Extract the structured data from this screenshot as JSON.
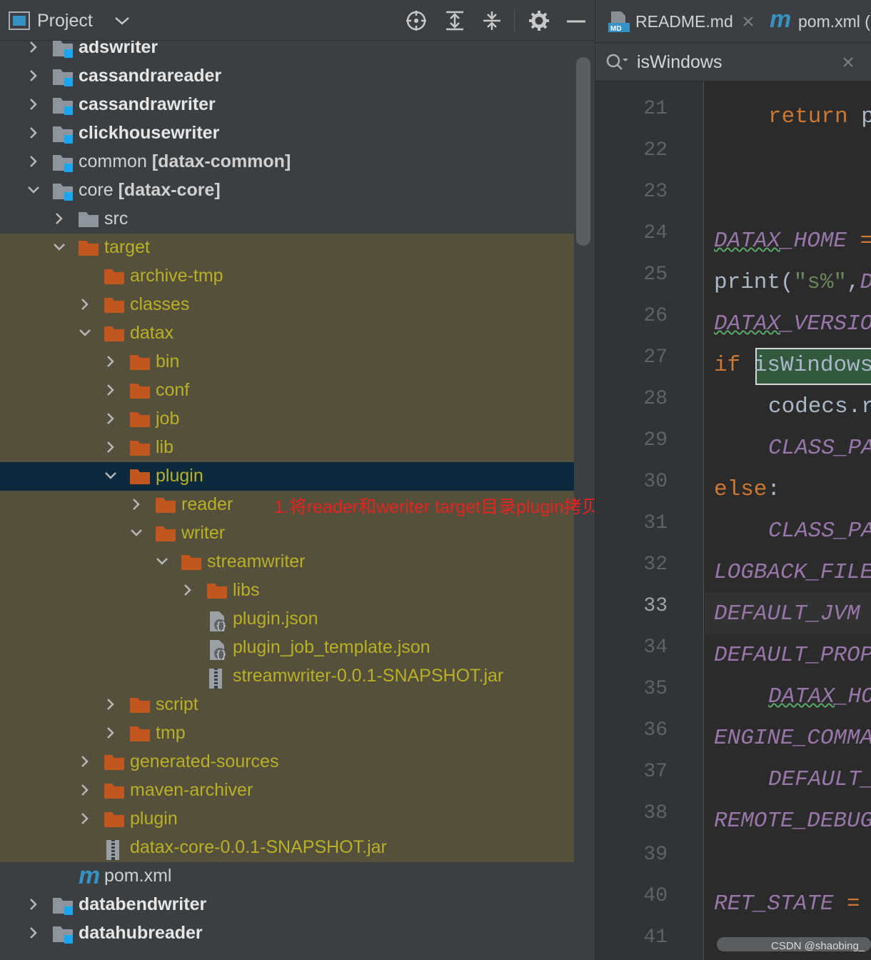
{
  "project_panel": {
    "title": "Project"
  },
  "tree": [
    {
      "label": "adswriter",
      "indent": 0,
      "arrow": "right",
      "icon": "module-folder",
      "style": "module"
    },
    {
      "label": "cassandrareader",
      "indent": 0,
      "arrow": "right",
      "icon": "module-folder",
      "style": "module"
    },
    {
      "label": "cassandrawriter",
      "indent": 0,
      "arrow": "right",
      "icon": "module-folder",
      "style": "module"
    },
    {
      "label": "clickhousewriter",
      "indent": 0,
      "arrow": "right",
      "icon": "module-folder",
      "style": "module"
    },
    {
      "label": "common ",
      "label_bold": "[datax-common]",
      "indent": 0,
      "arrow": "right",
      "icon": "module-folder",
      "style": "normal"
    },
    {
      "label": "core ",
      "label_bold": "[datax-core]",
      "indent": 0,
      "arrow": "down",
      "icon": "module-folder",
      "style": "normal"
    },
    {
      "label": "src",
      "indent": 1,
      "arrow": "right",
      "icon": "gray-folder",
      "style": "src"
    },
    {
      "label": "target",
      "indent": 1,
      "arrow": "down",
      "icon": "orange-folder",
      "style": "olive"
    },
    {
      "label": "archive-tmp",
      "indent": 2,
      "arrow": "none",
      "icon": "orange-folder",
      "style": "olive"
    },
    {
      "label": "classes",
      "indent": 2,
      "arrow": "right",
      "icon": "orange-folder",
      "style": "olive"
    },
    {
      "label": "datax",
      "indent": 2,
      "arrow": "down",
      "icon": "orange-folder",
      "style": "olive"
    },
    {
      "label": "bin",
      "indent": 3,
      "arrow": "right",
      "icon": "orange-folder",
      "style": "olive"
    },
    {
      "label": "conf",
      "indent": 3,
      "arrow": "right",
      "icon": "orange-folder",
      "style": "olive"
    },
    {
      "label": "job",
      "indent": 3,
      "arrow": "right",
      "icon": "orange-folder",
      "style": "olive"
    },
    {
      "label": "lib",
      "indent": 3,
      "arrow": "right",
      "icon": "orange-folder",
      "style": "olive"
    },
    {
      "label": "plugin",
      "indent": 3,
      "arrow": "down",
      "icon": "orange-folder",
      "style": "selected"
    },
    {
      "label": "reader",
      "indent": 4,
      "arrow": "right",
      "icon": "orange-folder",
      "style": "olive"
    },
    {
      "label": "writer",
      "indent": 4,
      "arrow": "down",
      "icon": "orange-folder",
      "style": "olive"
    },
    {
      "label": "streamwriter",
      "indent": 5,
      "arrow": "down",
      "icon": "orange-folder",
      "style": "olive"
    },
    {
      "label": "libs",
      "indent": 6,
      "arrow": "right",
      "icon": "orange-folder",
      "style": "olive"
    },
    {
      "label": "plugin.json",
      "indent": 6,
      "arrow": "none",
      "icon": "json-file",
      "style": "olive"
    },
    {
      "label": "plugin_job_template.json",
      "indent": 6,
      "arrow": "none",
      "icon": "json-file",
      "style": "olive"
    },
    {
      "label": "streamwriter-0.0.1-SNAPSHOT.jar",
      "indent": 6,
      "arrow": "none",
      "icon": "jar-file",
      "style": "olive"
    },
    {
      "label": "script",
      "indent": 3,
      "arrow": "right",
      "icon": "orange-folder",
      "style": "olive"
    },
    {
      "label": "tmp",
      "indent": 3,
      "arrow": "right",
      "icon": "orange-folder",
      "style": "olive"
    },
    {
      "label": "generated-sources",
      "indent": 2,
      "arrow": "right",
      "icon": "orange-folder",
      "style": "olive"
    },
    {
      "label": "maven-archiver",
      "indent": 2,
      "arrow": "right",
      "icon": "orange-folder",
      "style": "olive"
    },
    {
      "label": "plugin",
      "indent": 2,
      "arrow": "right",
      "icon": "orange-folder",
      "style": "olive"
    },
    {
      "label": "datax-core-0.0.1-SNAPSHOT.jar",
      "indent": 2,
      "arrow": "none",
      "icon": "jar-file",
      "style": "olive"
    },
    {
      "label": "pom.xml",
      "indent": 1,
      "arrow": "none",
      "icon": "maven-file",
      "style": "normal"
    },
    {
      "label": "databendwriter",
      "indent": 0,
      "arrow": "right",
      "icon": "module-folder",
      "style": "module"
    },
    {
      "label": "datahubreader",
      "indent": 0,
      "arrow": "right",
      "icon": "module-folder",
      "style": "module"
    }
  ],
  "annotation": "1.将reader和weriter target目录plugin拷贝",
  "editor": {
    "tabs": [
      {
        "label": "README.md",
        "icon": "markdown-icon"
      },
      {
        "label": "pom.xml (",
        "icon": "maven-icon"
      }
    ],
    "search": {
      "value": "isWindows"
    },
    "line_numbers": [
      "21",
      "22",
      "23",
      "24",
      "25",
      "26",
      "27",
      "28",
      "29",
      "30",
      "31",
      "32",
      "33",
      "34",
      "35",
      "36",
      "37",
      "38",
      "39",
      "40",
      "41"
    ],
    "current_line": "33",
    "code_lines": [
      {
        "line": "21",
        "indent": 2,
        "parts": [
          [
            "kw",
            "return"
          ],
          [
            "plain",
            " p"
          ]
        ]
      },
      {
        "line": "22",
        "indent": 0,
        "parts": []
      },
      {
        "line": "23",
        "indent": 0,
        "parts": []
      },
      {
        "line": "24",
        "indent": 0,
        "parts": [
          [
            "const-sq",
            "DATAX"
          ],
          [
            "const",
            "_HOME"
          ],
          [
            "plain",
            " "
          ],
          [
            "kw",
            "="
          ]
        ]
      },
      {
        "line": "25",
        "indent": 0,
        "parts": [
          [
            "plain",
            "print("
          ],
          [
            "str",
            "\"s%\""
          ],
          [
            "plain",
            ","
          ],
          [
            "const",
            "D"
          ]
        ]
      },
      {
        "line": "26",
        "indent": 0,
        "parts": [
          [
            "const-sq",
            "DATAX"
          ],
          [
            "const",
            "_VERSIO"
          ]
        ]
      },
      {
        "line": "27",
        "indent": 0,
        "parts": [
          [
            "kw",
            "if"
          ],
          [
            "plain",
            " isWindows"
          ]
        ]
      },
      {
        "line": "28",
        "indent": 2,
        "parts": [
          [
            "plain",
            "codecs.r"
          ]
        ]
      },
      {
        "line": "29",
        "indent": 2,
        "parts": [
          [
            "const",
            "CLASS_PA"
          ]
        ]
      },
      {
        "line": "30",
        "indent": 0,
        "parts": [
          [
            "kw",
            "else"
          ],
          [
            "plain",
            ":"
          ]
        ]
      },
      {
        "line": "31",
        "indent": 2,
        "parts": [
          [
            "const",
            "CLASS_PA"
          ]
        ]
      },
      {
        "line": "32",
        "indent": 0,
        "parts": [
          [
            "const",
            "LOGBACK_FILE"
          ]
        ]
      },
      {
        "line": "33",
        "indent": 0,
        "parts": [
          [
            "const",
            "DEFAULT_JVM"
          ]
        ]
      },
      {
        "line": "34",
        "indent": 0,
        "parts": [
          [
            "const",
            "DEFAULT_PROP"
          ]
        ]
      },
      {
        "line": "35",
        "indent": 2,
        "parts": [
          [
            "const-sq",
            "DATAX"
          ],
          [
            "const",
            "_HO"
          ]
        ]
      },
      {
        "line": "36",
        "indent": 0,
        "parts": [
          [
            "const",
            "ENGINE_COMMA"
          ]
        ]
      },
      {
        "line": "37",
        "indent": 2,
        "parts": [
          [
            "const",
            "DEFAULT_"
          ]
        ]
      },
      {
        "line": "38",
        "indent": 0,
        "parts": [
          [
            "const",
            "REMOTE_DEBUG"
          ]
        ]
      },
      {
        "line": "39",
        "indent": 0,
        "parts": []
      },
      {
        "line": "40",
        "indent": 0,
        "parts": [
          [
            "const",
            "RET_STATE"
          ],
          [
            "plain",
            " "
          ],
          [
            "kw",
            "="
          ]
        ]
      },
      {
        "line": "41",
        "indent": 0,
        "parts": []
      }
    ]
  },
  "watermark": "CSDN @shaobing_",
  "colors": {
    "panel_bg": "#3c3f41",
    "olive_bg": "#54503c",
    "selected_bg": "#0d293e",
    "olive_text": "#b9b026",
    "folder_orange": "#c1561f",
    "annotation_red": "#e6231e",
    "keyword": "#cc7832",
    "constant": "#9876aa",
    "string": "#6a8759"
  }
}
